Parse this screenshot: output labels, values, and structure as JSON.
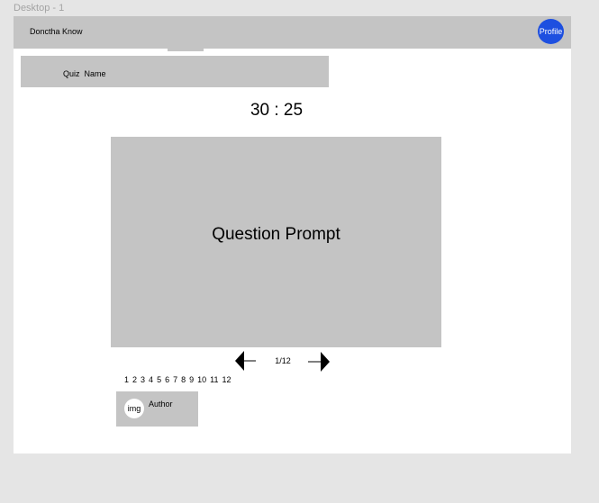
{
  "frame": {
    "label": "Desktop - 1"
  },
  "navbar": {
    "title": "Donctha Know",
    "profile_label": "Profile"
  },
  "quiz": {
    "name": "Quiz  Name",
    "timer": "30 : 25",
    "question_prompt": "Question Prompt"
  },
  "pagination": {
    "indicator": "1/12",
    "pages": [
      "1",
      "2",
      "3",
      "4",
      "5",
      "6",
      "7",
      "8",
      "9",
      "10",
      "11",
      "12"
    ]
  },
  "author": {
    "avatar_label": "img",
    "name": "Author"
  },
  "icons": {
    "prev": "arrow-left-icon",
    "next": "arrow-right-icon"
  },
  "colors": {
    "background": "#e5e5e5",
    "frame": "#ffffff",
    "placeholder": "#c4c4c4",
    "accent": "#1d4fe0"
  }
}
